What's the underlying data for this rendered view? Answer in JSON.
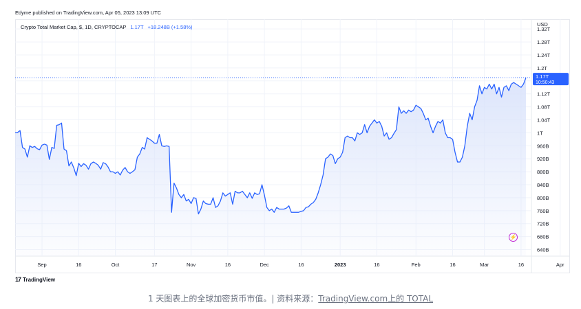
{
  "header": {
    "published": "Edyme published on TradingView.com, Apr 05, 2023 13:09 UTC"
  },
  "legend": {
    "symbol": "Crypto Total Market Cap, $, 1D, CRYPTOCAP",
    "last": "1.17T",
    "change": "+18.248B (+1.58%)"
  },
  "price_label": {
    "value": "1.17T",
    "time": "10:50:43"
  },
  "footer": {
    "brand": "TradingView"
  },
  "caption": {
    "prefix": "1 天图表上的全球加密货币市值。| 资料来源：",
    "link": "TradingView.com上的 TOTAL"
  },
  "colors": {
    "line": "#2962ff",
    "fill": "#dbe4fb",
    "accent": "#2962ff"
  },
  "chart_data": {
    "type": "area",
    "currency": "USD",
    "y_unit_label": "USD",
    "yticks": [
      "1.32T",
      "1.28T",
      "1.24T",
      "1.2T",
      "1.16T",
      "1.12T",
      "1.08T",
      "1.04T",
      "1T",
      "960B",
      "920B",
      "880B",
      "840B",
      "800B",
      "760B",
      "720B",
      "680B",
      "640B"
    ],
    "ytick_values": [
      1320,
      1280,
      1240,
      1200,
      1160,
      1120,
      1080,
      1040,
      1000,
      960,
      920,
      880,
      840,
      800,
      760,
      720,
      680,
      640
    ],
    "ylim": [
      620,
      1350
    ],
    "xticks": [
      {
        "label": "Sep",
        "x": "2022-09-01"
      },
      {
        "label": "16",
        "x": "2022-09-16"
      },
      {
        "label": "Oct",
        "x": "2022-10-01"
      },
      {
        "label": "17",
        "x": "2022-10-17"
      },
      {
        "label": "Nov",
        "x": "2022-11-01"
      },
      {
        "label": "16",
        "x": "2022-11-16"
      },
      {
        "label": "Dec",
        "x": "2022-12-01"
      },
      {
        "label": "16",
        "x": "2022-12-16"
      },
      {
        "label": "2023",
        "x": "2023-01-01"
      },
      {
        "label": "16",
        "x": "2023-01-16"
      },
      {
        "label": "Feb",
        "x": "2023-02-01"
      },
      {
        "label": "16",
        "x": "2023-02-16"
      },
      {
        "label": "Mar",
        "x": "2023-03-01"
      },
      {
        "label": "16",
        "x": "2023-03-16"
      },
      {
        "label": "Apr",
        "x": "2023-04-01"
      }
    ],
    "x_start": "2022-08-21",
    "current_price": 1170,
    "series": [
      {
        "values": [
          1000,
          1001,
          1007,
          955,
          950,
          925,
          960,
          955,
          958,
          951,
          948,
          962,
          965,
          962,
          918,
          955,
          952,
          1023,
          1025,
          1030,
          950,
          945,
          898,
          910,
          892,
          868,
          906,
          896,
          905,
          900,
          888,
          905,
          910,
          906,
          900,
          888,
          908,
          905,
          895,
          880,
          880,
          875,
          880,
          870,
          885,
          893,
          880,
          875,
          880,
          886,
          925,
          935,
          955,
          950,
          985,
          980,
          975,
          968,
          968,
          995,
          960,
          958,
          960,
          958,
          755,
          845,
          830,
          810,
          800,
          810,
          790,
          795,
          782,
          800,
          798,
          750,
          765,
          790,
          782,
          780,
          780,
          800,
          770,
          775,
          790,
          815,
          805,
          810,
          815,
          780,
          820,
          815,
          815,
          820,
          810,
          800,
          815,
          798,
          815,
          810,
          812,
          840,
          808,
          770,
          760,
          765,
          755,
          770,
          765,
          765,
          765,
          768,
          775,
          755,
          755,
          755,
          755,
          758,
          760,
          770,
          772,
          780,
          785,
          795,
          815,
          840,
          870,
          920,
          925,
          935,
          930,
          905,
          920,
          925,
          940,
          985,
          990,
          985,
          985,
          975,
          1000,
          995,
          1000,
          1025,
          1000,
          1020,
          1030,
          1040,
          1030,
          1035,
          1020,
          990,
          1000,
          980,
          985,
          998,
          1010,
          1080,
          1060,
          1068,
          1060,
          1070,
          1065,
          1070,
          1085,
          1080,
          1075,
          1060,
          1040,
          1045,
          1020,
          1000,
          1020,
          1035,
          1030,
          1040,
          1000,
          985,
          985,
          980,
          940,
          910,
          910,
          925,
          960,
          1020,
          1060,
          1040,
          1080,
          1100,
          1145,
          1120,
          1140,
          1135,
          1150,
          1135,
          1150,
          1120,
          1140,
          1110,
          1140,
          1145,
          1130,
          1150,
          1155,
          1150,
          1145,
          1140,
          1150,
          1170
        ]
      }
    ],
    "grid": true,
    "legend": "top-left"
  }
}
